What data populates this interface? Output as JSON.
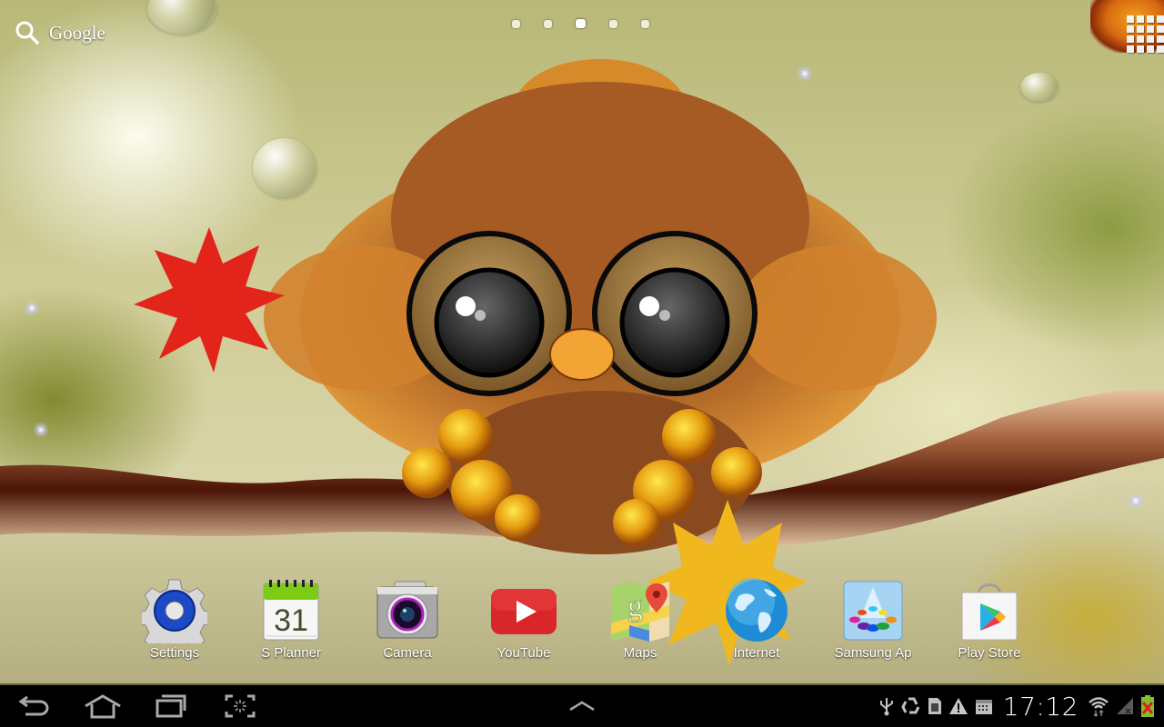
{
  "screen": {
    "type": "android_tablet_home_screen",
    "wallpaper": "autumn owl on branch live wallpaper"
  },
  "top_bar": {
    "search_label": "Google",
    "search_icon": "search-icon",
    "page_indicator": {
      "total": 5,
      "active_index": 2
    },
    "apps_button_icon": "apps-grid-icon"
  },
  "dock": {
    "apps": [
      {
        "label": "Settings",
        "icon": "settings-gear-icon"
      },
      {
        "label": "S Planner",
        "icon": "calendar-icon",
        "calendar_day": "31"
      },
      {
        "label": "Camera",
        "icon": "camera-icon"
      },
      {
        "label": "YouTube",
        "icon": "youtube-icon"
      },
      {
        "label": "Maps",
        "icon": "maps-icon"
      },
      {
        "label": "Internet",
        "icon": "globe-icon"
      },
      {
        "label": "Samsung Ap",
        "icon": "samsung-apps-icon"
      },
      {
        "label": "Play Store",
        "icon": "play-store-icon"
      }
    ]
  },
  "navbar": {
    "buttons": [
      {
        "name": "back",
        "icon": "back-icon"
      },
      {
        "name": "home",
        "icon": "home-icon"
      },
      {
        "name": "recent-apps",
        "icon": "recent-apps-icon"
      },
      {
        "name": "screenshot",
        "icon": "screenshot-icon"
      }
    ],
    "center_button": {
      "name": "mini-apps-tray",
      "icon": "chevron-up-icon"
    },
    "status": {
      "icons": [
        "usb-icon",
        "recycle-icon",
        "sd-card-icon",
        "warning-icon",
        "calendar-notification-icon"
      ],
      "time": "17:12",
      "wifi": "wifi-icon",
      "signal": "no-signal-icon",
      "battery": "battery-charging-error-icon"
    }
  },
  "colors": {
    "navbar_bg": "#000000",
    "icon_gray": "#b0b0b0",
    "label_text": "#ffffff",
    "youtube_red": "#d8262b",
    "settings_blue": "#1c49c6",
    "calendar_green": "#7ccc16",
    "battery_green": "#7ec02a",
    "battery_x_red": "#e02020"
  }
}
